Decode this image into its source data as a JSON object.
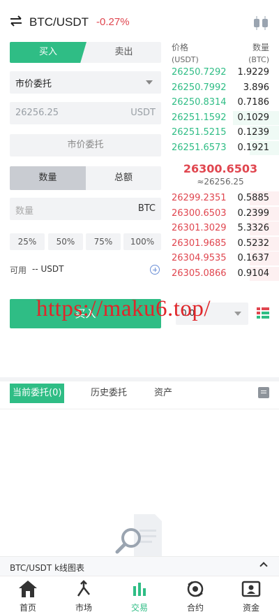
{
  "header": {
    "pair": "BTC/USDT",
    "change": "-0.27%",
    "swap_icon": "swap-arrows-icon",
    "chart_icon": "candlestick-icon"
  },
  "form": {
    "tab_buy": "买入",
    "tab_sell": "卖出",
    "order_type": "市价委托",
    "price_value": "26256.25",
    "price_unit": "USDT",
    "market_button": "市价委托",
    "tab_quantity": "数量",
    "tab_total": "总额",
    "quantity_placeholder": "数量",
    "quantity_unit": "BTC",
    "percent": [
      "25%",
      "50%",
      "75%",
      "100%"
    ],
    "available_label": "可用",
    "available_value": "-- USDT",
    "submit_label": "买入"
  },
  "orderbook": {
    "price_header": "价格",
    "qty_header": "数量",
    "price_unit": "(USDT)",
    "qty_unit": "(BTC)",
    "bids": [
      {
        "price": "26250.7292",
        "qty": "1.9229",
        "depth": 0.0
      },
      {
        "price": "26250.7992",
        "qty": "3.896",
        "depth": 0.0
      },
      {
        "price": "26250.8314",
        "qty": "0.7186",
        "depth": 0.0
      },
      {
        "price": "26251.1592",
        "qty": "0.1029",
        "depth": 0.47
      },
      {
        "price": "26251.5215",
        "qty": "0.1239",
        "depth": 0.3
      },
      {
        "price": "26251.6573",
        "qty": "0.1921",
        "depth": 0.3
      }
    ],
    "mid_price": "26300.6503",
    "mid_ref": "≈26256.25",
    "asks": [
      {
        "price": "26299.2351",
        "qty": "0.5885",
        "depth": 0.3
      },
      {
        "price": "26300.6503",
        "qty": "0.2399",
        "depth": 0.3
      },
      {
        "price": "26301.3029",
        "qty": "5.3326",
        "depth": 0.3
      },
      {
        "price": "26301.9685",
        "qty": "0.5232",
        "depth": 0.3
      },
      {
        "price": "26304.9535",
        "qty": "0.1637",
        "depth": 0.3
      },
      {
        "price": "26305.0866",
        "qty": "0.9104",
        "depth": 0.3
      }
    ],
    "depth_select": "0.0",
    "layout_icon": "orderbook-layout-icon"
  },
  "watermark": "https://maku6.top/",
  "orders": {
    "tab_current": "当前委托(0)",
    "tab_history": "历史委托",
    "tab_assets": "资产",
    "doc_icon": "orders-list-icon",
    "empty_icon": "empty-search-icon"
  },
  "kline": {
    "label": "BTC/USDT k线图表",
    "toggle_icon": "chevron-up-icon"
  },
  "nav": [
    {
      "label": "首页",
      "icon": "home-icon",
      "active": false
    },
    {
      "label": "市场",
      "icon": "market-icon",
      "active": false
    },
    {
      "label": "交易",
      "icon": "trade-icon",
      "active": true
    },
    {
      "label": "合约",
      "icon": "contract-icon",
      "active": false
    },
    {
      "label": "资金",
      "icon": "funds-icon",
      "active": false
    }
  ],
  "colors": {
    "green": "#2fbd85",
    "red": "#e0464f"
  }
}
